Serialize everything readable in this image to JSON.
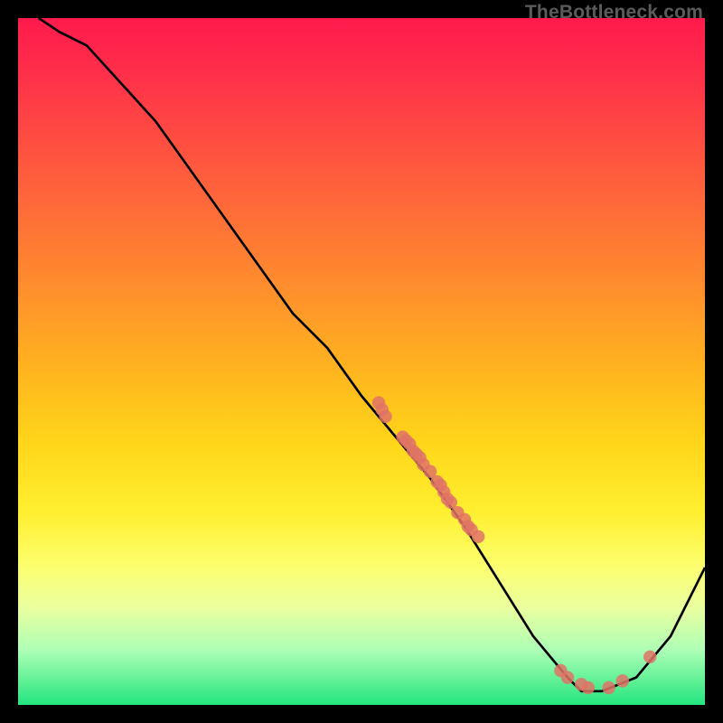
{
  "watermark": "TheBottleneck.com",
  "chart_data": {
    "type": "line",
    "title": "",
    "xlabel": "",
    "ylabel": "",
    "xlim": [
      0,
      100
    ],
    "ylim": [
      0,
      100
    ],
    "series": [
      {
        "name": "bottleneck-curve",
        "x": [
          3,
          6,
          10,
          20,
          30,
          40,
          45,
          50,
          55,
          60,
          65,
          70,
          75,
          80,
          82,
          85,
          90,
          95,
          100
        ],
        "y": [
          100,
          98,
          96,
          85,
          71,
          57,
          52,
          45,
          39,
          33,
          26,
          18,
          10,
          4,
          2,
          2,
          4,
          10,
          20
        ]
      }
    ],
    "points": [
      {
        "x": 52.5,
        "y": 44
      },
      {
        "x": 53,
        "y": 43
      },
      {
        "x": 53.5,
        "y": 42
      },
      {
        "x": 56,
        "y": 39
      },
      {
        "x": 56.5,
        "y": 38.5
      },
      {
        "x": 57,
        "y": 38
      },
      {
        "x": 57.5,
        "y": 37
      },
      {
        "x": 58,
        "y": 36.5
      },
      {
        "x": 58.5,
        "y": 36
      },
      {
        "x": 59,
        "y": 35
      },
      {
        "x": 60,
        "y": 34
      },
      {
        "x": 61,
        "y": 32.5
      },
      {
        "x": 61.5,
        "y": 32
      },
      {
        "x": 62,
        "y": 31
      },
      {
        "x": 62.5,
        "y": 30
      },
      {
        "x": 63,
        "y": 29.5
      },
      {
        "x": 64,
        "y": 28
      },
      {
        "x": 65,
        "y": 27
      },
      {
        "x": 65.5,
        "y": 26
      },
      {
        "x": 66,
        "y": 25.5
      },
      {
        "x": 67,
        "y": 24.5
      },
      {
        "x": 79,
        "y": 5
      },
      {
        "x": 80,
        "y": 4
      },
      {
        "x": 82,
        "y": 3
      },
      {
        "x": 83,
        "y": 2.5
      },
      {
        "x": 86,
        "y": 2.5
      },
      {
        "x": 88,
        "y": 3.5
      },
      {
        "x": 92,
        "y": 7
      }
    ],
    "marker_color": "#e17366",
    "line_color": "#000000"
  }
}
